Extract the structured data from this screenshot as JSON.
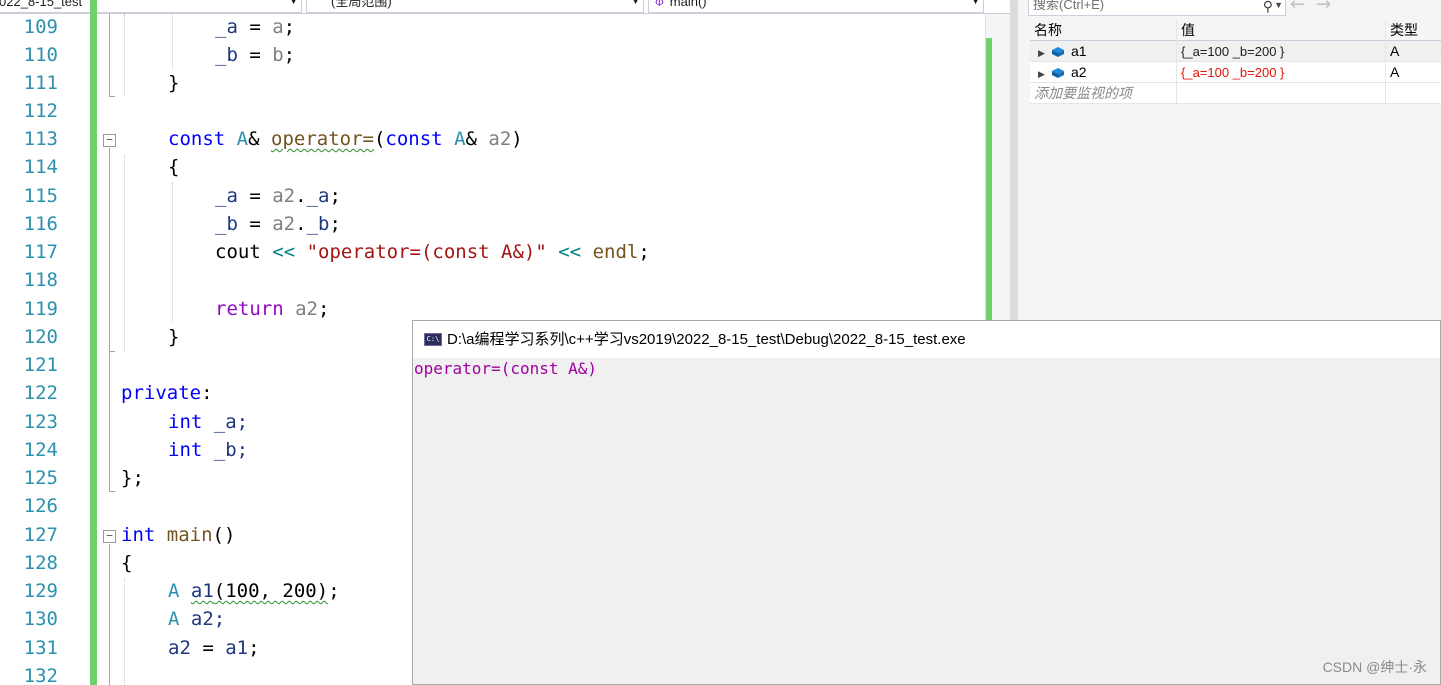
{
  "nav": {
    "project": "022_8-15_test",
    "scope": "(全局范围)",
    "function": "main()"
  },
  "line_numbers": [
    "109",
    "110",
    "111",
    "112",
    "113",
    "114",
    "115",
    "116",
    "117",
    "118",
    "119",
    "120",
    "121",
    "122",
    "123",
    "124",
    "125",
    "126",
    "127",
    "128",
    "129",
    "130",
    "131",
    "132"
  ],
  "code": {
    "l109": [
      "_a",
      " = ",
      "a",
      ";"
    ],
    "l110": [
      "_b",
      " = ",
      "b",
      ";"
    ],
    "l111": "}",
    "l113": [
      "const",
      " ",
      "A",
      "& ",
      "operator=",
      "(",
      "const",
      " ",
      "A",
      "& ",
      "a2",
      ")"
    ],
    "l114": "{",
    "l115": [
      "_a",
      " = ",
      "a2",
      ".",
      "_a",
      ";"
    ],
    "l116": [
      "_b",
      " = ",
      "a2",
      ".",
      "_b",
      ";"
    ],
    "l117": [
      "cout",
      " ",
      "<<",
      " ",
      "\"operator=(const A&)\"",
      " ",
      "<<",
      " ",
      "endl",
      ";"
    ],
    "l119": [
      "return",
      " ",
      "a2",
      ";"
    ],
    "l120": "}",
    "l122": [
      "private",
      ":"
    ],
    "l123": [
      "int",
      " _a;"
    ],
    "l124": [
      "int",
      " _b;"
    ],
    "l125": "};",
    "l127": [
      "int",
      " ",
      "main",
      "()"
    ],
    "l128": "{",
    "l129": [
      "A",
      " ",
      "a1",
      "(100, 200)",
      ";"
    ],
    "l130": [
      "A",
      " a2;"
    ],
    "l131": [
      "a2",
      " = ",
      "a1",
      ";"
    ]
  },
  "watch": {
    "search_placeholder": "搜索(Ctrl+E)",
    "columns": [
      "名称",
      "值",
      "类型"
    ],
    "rows": [
      {
        "name": "a1",
        "value": "{_a=100 _b=200 }",
        "type": "A",
        "changed": false
      },
      {
        "name": "a2",
        "value": "{_a=100 _b=200 }",
        "type": "A",
        "changed": true
      }
    ],
    "add_placeholder": "添加要监视的项"
  },
  "console": {
    "icon_text": "C:\\",
    "title": "D:\\a编程学习系列\\c++学习vs2019\\2022_8-15_test\\Debug\\2022_8-15_test.exe",
    "output": "operator=(const A&)"
  },
  "watermark": "CSDN @绅士·永",
  "colors": {
    "keyword": "#0000ff",
    "control_keyword": "#8f08c4",
    "type": "#2b91af",
    "string": "#a31515",
    "line_number": "#2b91af",
    "change_bar": "#6ed16e",
    "changed_value": "#e51400",
    "console_text": "#a000a0"
  },
  "icons": {
    "fold": "minus-box-icon",
    "function": "function-icon",
    "search": "search-icon",
    "variable": "variable-cube-icon",
    "console": "console-icon"
  }
}
